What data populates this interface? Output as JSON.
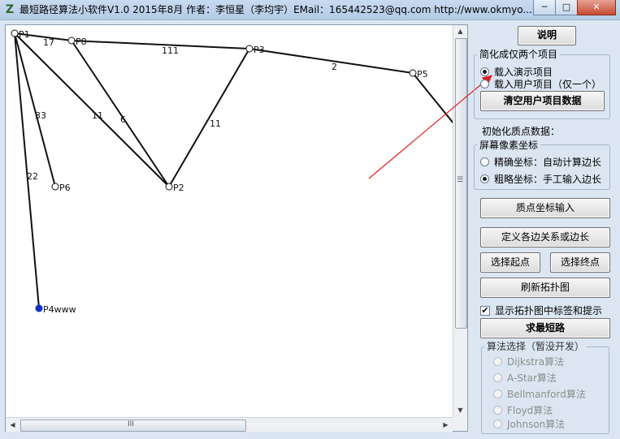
{
  "window": {
    "title": "最短路径算法小软件V1.0  2015年8月 作者：李恒星（李均宇）EMail：165442523@qq.com  http://www.okmyo...",
    "app_icon": "Z",
    "minimize_label": "─",
    "maximize_label": "□",
    "close_label": "✕"
  },
  "canvas": {
    "nodes": [
      {
        "id": "P1",
        "label": "P1",
        "fill": "#ffffff"
      },
      {
        "id": "P8",
        "label": "P8",
        "fill": "#ffffff"
      },
      {
        "id": "P3",
        "label": "P3",
        "fill": "#ffffff"
      },
      {
        "id": "P5",
        "label": "P5",
        "fill": "#ffffff"
      },
      {
        "id": "P6",
        "label": "P6",
        "fill": "#ffffff"
      },
      {
        "id": "P2",
        "label": "P2",
        "fill": "#ffffff"
      },
      {
        "id": "P4",
        "label": "P4www",
        "fill": "#1030c8"
      }
    ],
    "edges": [
      {
        "from": "P1",
        "to": "P8",
        "weight": "17"
      },
      {
        "from": "P8",
        "to": "P3",
        "weight": "111"
      },
      {
        "from": "P3",
        "to": "P5",
        "weight": "2"
      },
      {
        "from": "P1",
        "to": "P6",
        "weight": "33"
      },
      {
        "from": "P1",
        "to": "P2",
        "weight": "11"
      },
      {
        "from": "P8",
        "to": "P2",
        "weight": "6"
      },
      {
        "from": "P3",
        "to": "P2",
        "weight": "11"
      },
      {
        "from": "P1",
        "to": "P4",
        "weight": "22"
      },
      {
        "from": "P5",
        "to": "offscreen",
        "weight": ""
      }
    ],
    "scroll_h_grip": "III",
    "scroll_v_grip": "☰"
  },
  "panel": {
    "help_button": "说明",
    "project_group": {
      "legend": "简化成仅两个项目",
      "radio_demo": "载入演示项目",
      "radio_user": "载入用户项目（仅一个）",
      "selected": "demo",
      "clear_button": "清空用户项目数据"
    },
    "init_label": "初始化质点数据：",
    "coord_group": {
      "legend": "屏幕像素坐标",
      "radio_precise": "精确坐标：自动计算边长",
      "radio_rough": "粗略坐标：手工输入边长",
      "selected": "rough"
    },
    "btn_coord_input": "质点坐标输入",
    "btn_define_edges": "定义各边关系或边长",
    "btn_start": "选择起点",
    "btn_end": "选择终点",
    "btn_refresh": "刷新拓扑图",
    "show_labels_checkbox": "显示拓扑图中标签和提示",
    "show_labels_checked": true,
    "btn_solve": "求最短路",
    "algo_group": {
      "legend": "算法选择（暂没开发）",
      "options": [
        "Dijkstra算法",
        "A-Star算法",
        "Bellmanford算法",
        "Floyd算法",
        "Johnson算法"
      ]
    }
  },
  "colors": {
    "annotation_arrow": "#e02020",
    "selected_node": "#1030c8"
  }
}
